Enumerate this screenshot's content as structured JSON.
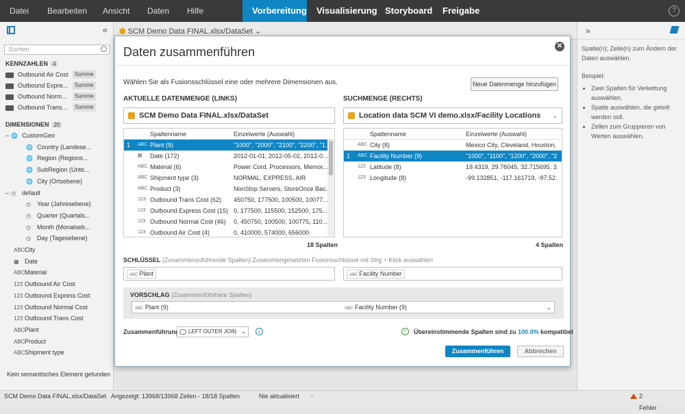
{
  "menu": {
    "items": [
      "Datei",
      "Bearbeiten",
      "Ansicht",
      "Daten",
      "Hilfe"
    ],
    "modes": [
      "Vorbereitung",
      "Visualisierung",
      "Storyboard",
      "Freigabe"
    ],
    "help": "?"
  },
  "left": {
    "collapse": "«",
    "search_placeholder": "Suchen",
    "measures_title": "KENNZAHLEN",
    "measures_count": "4",
    "measures": [
      {
        "label": "Outbound Air Cost",
        "agg": "Summe"
      },
      {
        "label": "Outbound Expre...",
        "agg": "Summe"
      },
      {
        "label": "Outbound Norm...",
        "agg": "Summe"
      },
      {
        "label": "Outbound Trans...",
        "agg": "Summe"
      }
    ],
    "dims_title": "DIMENSIONEN",
    "dims_count": "20",
    "dims": [
      {
        "label": "CustomGeo",
        "icon": "globe-icon"
      },
      {
        "label": "Country (Landese...",
        "icon": "globe-icon"
      },
      {
        "label": "Region (Regions...",
        "icon": "globe-icon"
      },
      {
        "label": "SubRegion (Unte...",
        "icon": "globe-icon"
      },
      {
        "label": "City (Ortsebene)",
        "icon": "globe-icon"
      },
      {
        "label": "default",
        "icon": "clock-icon"
      },
      {
        "label": "Year (Jahresebene)",
        "icon": "clock-icon"
      },
      {
        "label": "Quarter (Quartals...",
        "icon": "clock-icon"
      },
      {
        "label": "Month (Monatseb...",
        "icon": "clock-icon"
      },
      {
        "label": "Day (Tagesebene)",
        "icon": "clock-icon"
      },
      {
        "label": "City",
        "icon": "ABC"
      },
      {
        "label": "Date",
        "icon": "calendar-icon"
      },
      {
        "label": "Material",
        "icon": "ABC"
      },
      {
        "label": "Outbound Air Cost",
        "icon": "123"
      },
      {
        "label": "Outbound Express Cost",
        "icon": "123"
      },
      {
        "label": "Outbound Normal Cost",
        "icon": "123"
      },
      {
        "label": "Outbound Trans Cost",
        "icon": "123"
      },
      {
        "label": "Plant",
        "icon": "ABC"
      },
      {
        "label": "Product",
        "icon": "ABC"
      },
      {
        "label": "Shipment type",
        "icon": "ABC"
      }
    ],
    "footer": "Kein semantisches Element gefunden"
  },
  "workbar": {
    "dataset": "SCM Demo Data FINAL.xlsx/DataSet"
  },
  "right": {
    "line1": "Spalte(n); Zelle(n) zum Ändern der Daten auswählen.",
    "example": "Beispiel:",
    "bullets": [
      "Zwei Spalten für Verkettung auswählen.",
      "Spalte auswählen, die geteilt werden soll.",
      "Zellen zum Gruppieren von Werten auswählen."
    ]
  },
  "status": {
    "dataset": "SCM Demo Data FINAL.xlsx/DataSet",
    "rows": "Angezeigt: 13968/13968 Zeilen - 18/18 Spalten",
    "updated": "Nie aktualisiert",
    "dash": "-",
    "errors": "2 Fehler"
  },
  "dialog": {
    "title": "Daten zusammenführen",
    "close": "✕",
    "intro": "Wählen Sie als Fusionsschlüssel eine oder mehrere Dimensionen aus.",
    "add_dataset": "Neue Datenmenge hinzufügen",
    "left_header": "AKTUELLE DATENMENGE (LINKS)",
    "right_header": "SUCHMENGE (RECHTS)",
    "left_dataset": "SCM Demo Data FINAL.xlsx/DataSet",
    "right_dataset": "Location data SCM  VI demo.xlsx/Facility Locations",
    "col_name": "Spaltenname",
    "col_values": "Einzelwerte (Auswahl)",
    "left_rows": [
      {
        "num": "1",
        "type": "ABC",
        "name": "Plant  (9)",
        "values": "\"1000\", \"2000\", \"2100\", \"2200\", \"1...",
        "sel": true
      },
      {
        "num": "",
        "type": "cal",
        "name": "Date  (172)",
        "values": "2012-01-01, 2012-05-02, 2012-0..."
      },
      {
        "num": "",
        "type": "ABC",
        "name": "Material  (6)",
        "values": "Power Cord, Processors, Memor..."
      },
      {
        "num": "",
        "type": "ABC",
        "name": "Shipment type  (3)",
        "values": "NORMAL, EXPRESS, AIR"
      },
      {
        "num": "",
        "type": "ABC",
        "name": "Product  (3)",
        "values": "NonStop Servers, StoreOnce Bac..."
      },
      {
        "num": "",
        "type": "123",
        "name": "Outbound Trans Cost  (62)",
        "values": "450750, 177500, 100500, 10077..."
      },
      {
        "num": "",
        "type": "123",
        "name": "Outbound Express Cost  (15)",
        "values": "0, 177500, 115500, 152500, 175..."
      },
      {
        "num": "",
        "type": "123",
        "name": "Outbound Normal Cost  (46)",
        "values": "0, 450750, 100500, 100775, 110..."
      },
      {
        "num": "",
        "type": "123",
        "name": "Outbound Air Cost  (4)",
        "values": "0, 410000, 574000, 656000"
      }
    ],
    "right_rows": [
      {
        "num": "",
        "type": "ABC",
        "name": "City  (8)",
        "values": "Mexico City, Cleveland, Houston, ..."
      },
      {
        "num": "1",
        "type": "ABC",
        "name": "Facility Number  (9)",
        "values": "\"1000\", \"1100\", \"1200\", \"2000\", \"2...",
        "sel": true
      },
      {
        "num": "",
        "type": "123",
        "name": "Latitude  (8)",
        "values": "19.4319, 29.76045, 32.715695, 3..."
      },
      {
        "num": "",
        "type": "123",
        "name": "Longitude  (8)",
        "values": "-99.132851, -117.161719, -97.52..."
      }
    ],
    "left_count": "18 Spalten",
    "right_count": "4 Spalten",
    "key_label": "SCHLÜSSEL",
    "key_hint": "(Zusammenzuführende Spalten) Zusammengesetzten Fusionsschlüssel mit Strg + Klick auswählen",
    "key_left": "Plant",
    "key_right": "Facility Number",
    "abc": "ABC",
    "suggest_label": "VORSCHLAG",
    "suggest_hint": "(Zusammenführbare Spalten)",
    "suggest_left": "Plant (9)",
    "suggest_right": "Facility Number (9)",
    "join_label": "Zusammenführung",
    "join_value": "LEFT OUTER JOIN",
    "match_text": "Übereinstimmende Spalten sind zu",
    "match_pct": "100.0%",
    "match_suffix": "kompatibel",
    "merge_btn": "Zusammenführen",
    "cancel_btn": "Abbrechen"
  }
}
